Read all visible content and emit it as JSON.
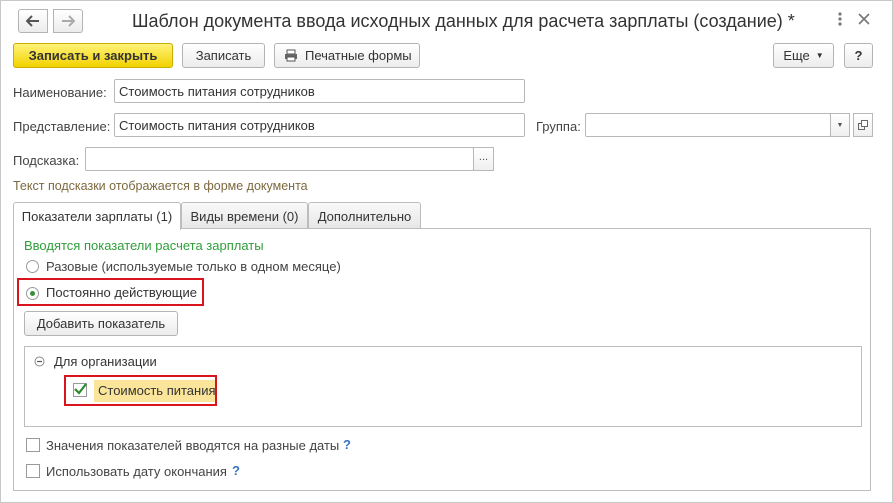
{
  "window": {
    "title": "Шаблон документа ввода исходных данных для расчета зарплаты (создание) *",
    "more_menu_icon": "more-menu-icon",
    "close_icon": "close-icon"
  },
  "toolbar": {
    "save_close_label": "Записать и закрыть",
    "save_label": "Записать",
    "print_label": "Печатные формы",
    "more_label": "Еще",
    "help_label": "?"
  },
  "form": {
    "name_label": "Наименование:",
    "name_value": "Стоимость питания сотрудников",
    "presentation_label": "Представление:",
    "presentation_value": "Стоимость питания сотрудников",
    "group_label": "Группа:",
    "group_value": "",
    "hint_label": "Подсказка:",
    "hint_value": "",
    "hint_note": "Текст подсказки отображается в форме документа"
  },
  "tabs": [
    {
      "label": "Показатели зарплаты (1)",
      "active": true
    },
    {
      "label": "Виды времени (0)",
      "active": false
    },
    {
      "label": "Дополнительно",
      "active": false
    }
  ],
  "indicators": {
    "section_title": "Вводятся показатели расчета зарплаты",
    "option_onetime": "Разовые (используемые только в одном месяце)",
    "option_permanent": "Постоянно действующие",
    "selected_option": "permanent",
    "add_button_label": "Добавить показатель",
    "tree": {
      "group_label": "Для организации",
      "items": [
        {
          "label": "Стоимость питания",
          "checked": true
        }
      ]
    },
    "diff_dates_label": "Значения показателей вводятся на разные даты",
    "diff_dates_checked": false,
    "end_date_label": "Использовать дату окончания",
    "end_date_checked": false,
    "help_mark": "?"
  },
  "colors": {
    "primary_button": "#f2d200",
    "section_title_green": "#2f9e3a",
    "hint_text": "#7c6a3f",
    "highlight_border": "#d9141d",
    "help_mark": "#3a73c4"
  }
}
